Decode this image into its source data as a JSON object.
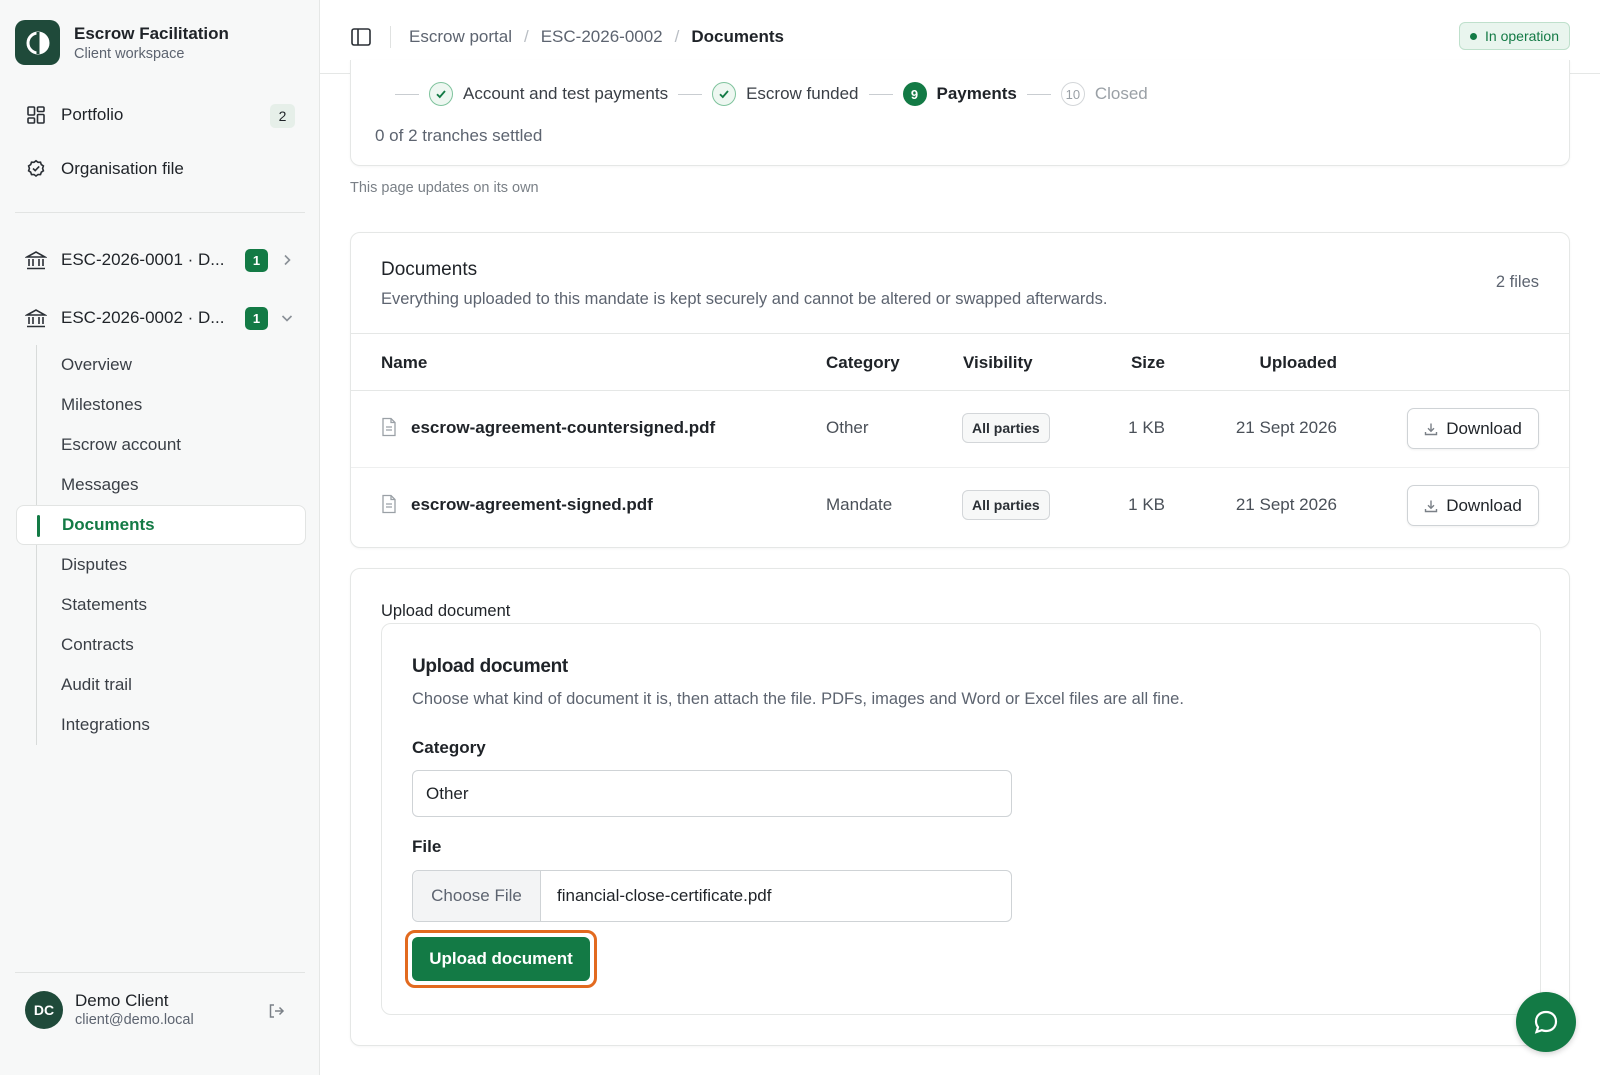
{
  "brand": {
    "title": "Escrow Facilitation",
    "subtitle": "Client workspace"
  },
  "sidebar": {
    "top_items": [
      {
        "label": "Portfolio",
        "icon": "grid-icon",
        "count": "2"
      },
      {
        "label": "Organisation file",
        "icon": "check-circle-icon"
      }
    ],
    "mandates": [
      {
        "label": "ESC-2026-0001 · D...",
        "badge": "1",
        "icon": "bank-icon",
        "expanded": false
      },
      {
        "label": "ESC-2026-0002 · D...",
        "badge": "1",
        "icon": "bank-icon",
        "expanded": true
      }
    ],
    "subnav": [
      "Overview",
      "Milestones",
      "Escrow account",
      "Messages",
      "Documents",
      "Disputes",
      "Statements",
      "Contracts",
      "Audit trail",
      "Integrations"
    ],
    "active_subnav": "Documents",
    "user": {
      "initials": "DC",
      "name": "Demo Client",
      "email": "client@demo.local"
    }
  },
  "header": {
    "breadcrumbs": [
      "Escrow portal",
      "ESC-2026-0002",
      "Documents"
    ],
    "status": "In operation"
  },
  "progress": {
    "steps": [
      {
        "label": "Account and test payments",
        "state": "done"
      },
      {
        "label": "Escrow funded",
        "state": "done"
      },
      {
        "label": "Payments",
        "state": "active",
        "number": "9"
      },
      {
        "label": "Closed",
        "state": "future",
        "number": "10"
      }
    ],
    "tranches": "0 of 2 tranches settled",
    "note": "This page updates on its own"
  },
  "documents": {
    "title": "Documents",
    "description": "Everything uploaded to this mandate is kept securely and cannot be altered or swapped afterwards.",
    "count": "2 files",
    "columns": [
      "Name",
      "Category",
      "Visibility",
      "Size",
      "Uploaded"
    ],
    "rows": [
      {
        "name": "escrow-agreement-countersigned.pdf",
        "category": "Other",
        "visibility": "All parties",
        "size": "1 KB",
        "uploaded": "21 Sept 2026",
        "action": "Download"
      },
      {
        "name": "escrow-agreement-signed.pdf",
        "category": "Mandate",
        "visibility": "All parties",
        "size": "1 KB",
        "uploaded": "21 Sept 2026",
        "action": "Download"
      }
    ]
  },
  "upload": {
    "section_title": "Upload document",
    "form_title": "Upload document",
    "form_description": "Choose what kind of document it is, then attach the file. PDFs, images and Word or Excel files are all fine.",
    "category_label": "Category",
    "category_value": "Other",
    "file_label": "File",
    "choose_file": "Choose File",
    "file_name": "financial-close-certificate.pdf",
    "submit_label": "Upload document"
  },
  "colors": {
    "brand": "#137a45",
    "brand_dark": "#1f4a3a",
    "focus_ring": "#e26a1f"
  }
}
